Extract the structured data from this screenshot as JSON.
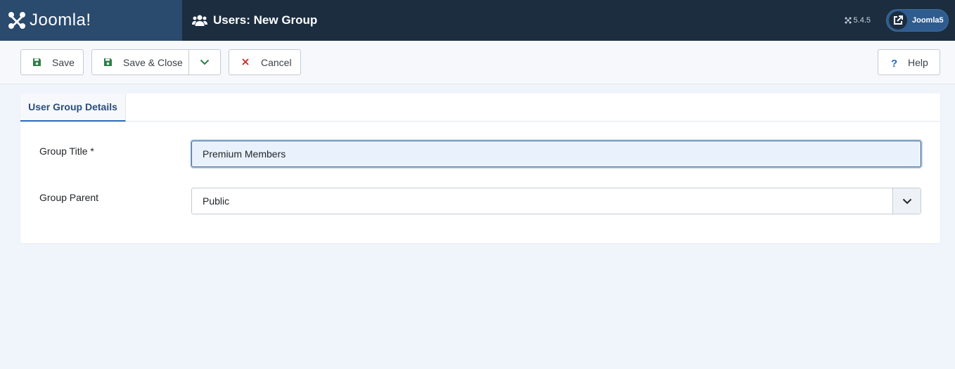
{
  "header": {
    "brand": "Joomla!",
    "page_title": "Users: New Group",
    "version": "5.4.5",
    "site_button_label": "Joomla5"
  },
  "toolbar": {
    "save_label": "Save",
    "save_close_label": "Save & Close",
    "cancel_label": "Cancel",
    "help_label": "Help"
  },
  "tabs": [
    {
      "label": "User Group Details",
      "active": true
    }
  ],
  "form": {
    "group_title_label": "Group Title *",
    "group_title_value": "Premium Members",
    "group_parent_label": "Group Parent",
    "group_parent_value": "Public"
  },
  "colors": {
    "header_bg": "#1c2d40",
    "logo_bg": "#2a4a6e",
    "accent": "#2a69b8",
    "save_green": "#2f7d48",
    "cancel_red": "#c52827",
    "help_blue": "#2a69b8"
  }
}
